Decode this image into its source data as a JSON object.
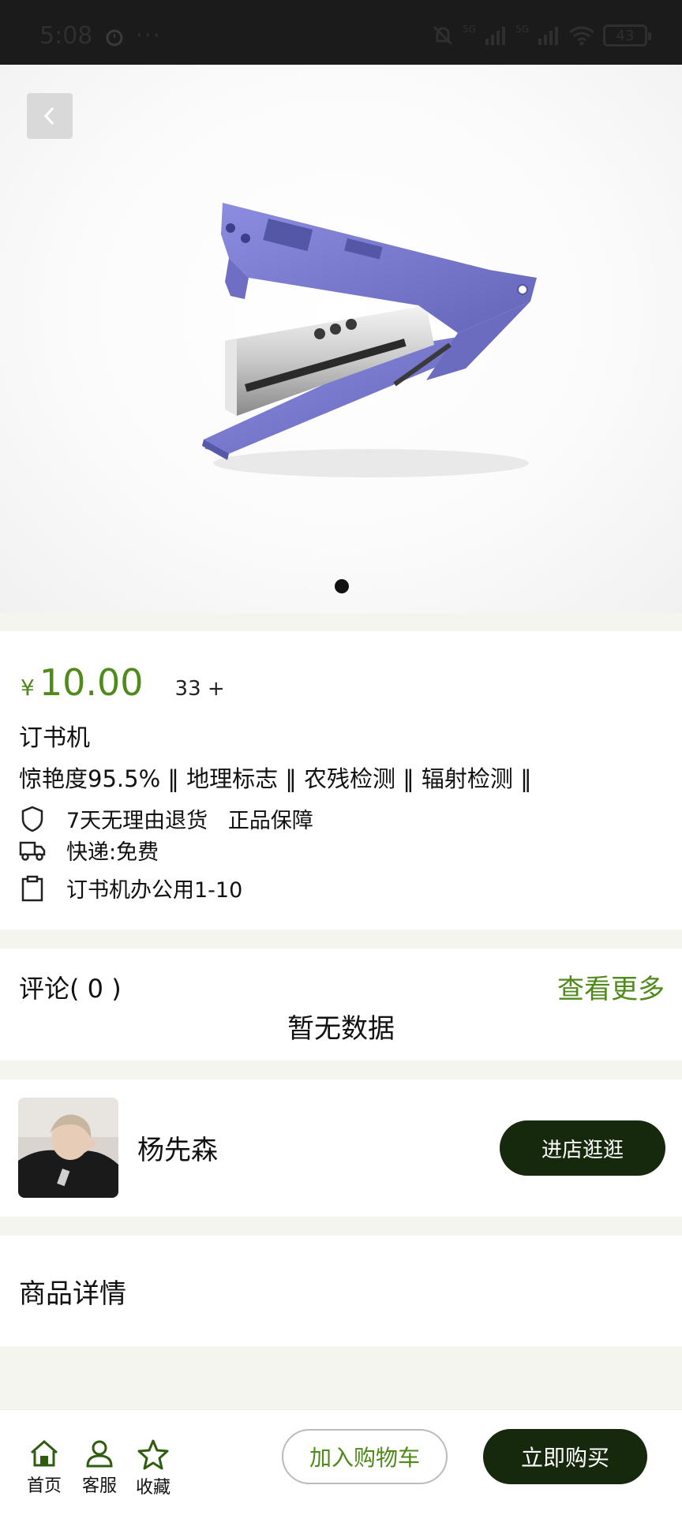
{
  "status_bar": {
    "time": "5:08",
    "dots": "···",
    "signal_1": "5G",
    "signal_2": "5G",
    "battery": "43"
  },
  "product": {
    "price_symbol": "¥",
    "price": "10.00",
    "sold": "33 +",
    "title": "订书机",
    "tags": "惊艳度95.5% ‖ 地理标志 ‖ 农残检测 ‖ 辐射检测 ‖",
    "features": [
      {
        "icon": "shield-icon",
        "text": "7天无理由退货   正品保障"
      },
      {
        "icon": "truck-icon",
        "text": "快递:免费"
      },
      {
        "icon": "clipboard-icon",
        "text": "订书机办公用1-10"
      }
    ],
    "image_icon": "stapler-image"
  },
  "comments": {
    "label": "评论( 0 )",
    "more": "查看更多",
    "empty": "暂无数据"
  },
  "shop": {
    "name": "杨先森",
    "button": "进店逛逛"
  },
  "details": {
    "heading": "商品详情"
  },
  "bottom_bar": {
    "home": "首页",
    "service": "客服",
    "favorite": "收藏",
    "add_cart": "加入购物车",
    "buy_now": "立即购买"
  },
  "colors": {
    "accent_green": "#4f8a1a",
    "dark_green": "#16290c",
    "stapler_purple": "#7b7ccf"
  }
}
